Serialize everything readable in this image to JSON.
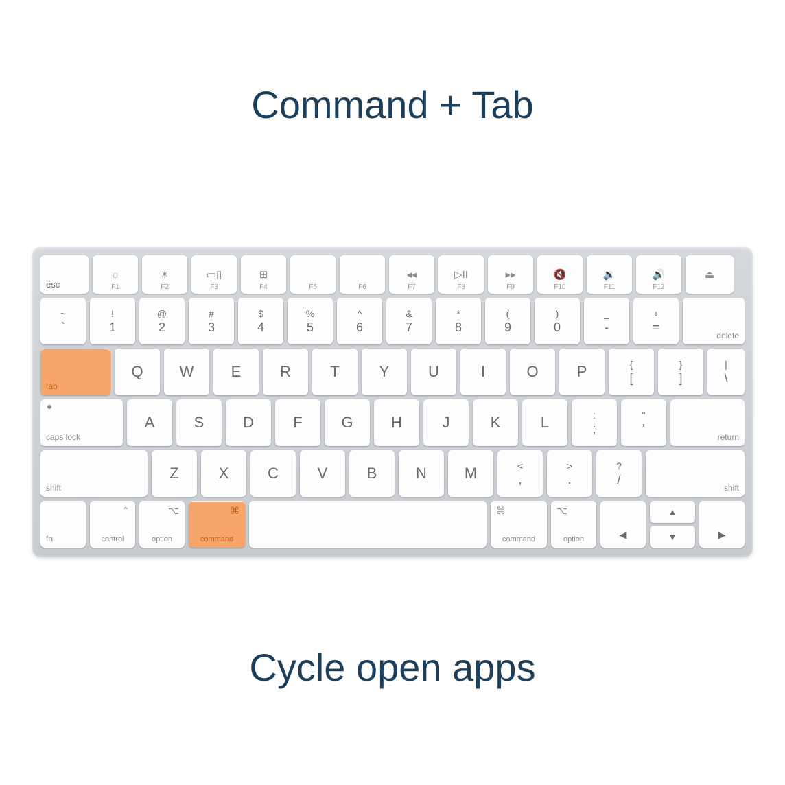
{
  "title": "Command + Tab",
  "caption": "Cycle open apps",
  "highlight_color": "#f7a56b",
  "keyboard": {
    "fn_row": {
      "esc": "esc",
      "keys": [
        {
          "icon": "☼",
          "label": "F1"
        },
        {
          "icon": "☀",
          "label": "F2"
        },
        {
          "icon": "▭▯",
          "label": "F3"
        },
        {
          "icon": "⊞",
          "label": "F4"
        },
        {
          "icon": "",
          "label": "F5"
        },
        {
          "icon": "",
          "label": "F6"
        },
        {
          "icon": "◂◂",
          "label": "F7"
        },
        {
          "icon": "▷II",
          "label": "F8"
        },
        {
          "icon": "▸▸",
          "label": "F9"
        },
        {
          "icon": "🔇",
          "label": "F10"
        },
        {
          "icon": "🔉",
          "label": "F11"
        },
        {
          "icon": "🔊",
          "label": "F12"
        }
      ],
      "eject": "⏏"
    },
    "num_row": [
      {
        "top": "~",
        "bot": "`"
      },
      {
        "top": "!",
        "bot": "1"
      },
      {
        "top": "@",
        "bot": "2"
      },
      {
        "top": "#",
        "bot": "3"
      },
      {
        "top": "$",
        "bot": "4"
      },
      {
        "top": "%",
        "bot": "5"
      },
      {
        "top": "^",
        "bot": "6"
      },
      {
        "top": "&",
        "bot": "7"
      },
      {
        "top": "*",
        "bot": "8"
      },
      {
        "top": "(",
        "bot": "9"
      },
      {
        "top": ")",
        "bot": "0"
      },
      {
        "top": "_",
        "bot": "-"
      },
      {
        "top": "+",
        "bot": "="
      }
    ],
    "delete": "delete",
    "tab": "tab",
    "q_row": [
      "Q",
      "W",
      "E",
      "R",
      "T",
      "Y",
      "U",
      "I",
      "O",
      "P"
    ],
    "brackets": [
      {
        "top": "{",
        "bot": "["
      },
      {
        "top": "}",
        "bot": "]"
      },
      {
        "top": "|",
        "bot": "\\"
      }
    ],
    "caps": "caps lock",
    "a_row": [
      "A",
      "S",
      "D",
      "F",
      "G",
      "H",
      "J",
      "K",
      "L"
    ],
    "punct_a": [
      {
        "top": ":",
        "bot": ";"
      },
      {
        "top": "\"",
        "bot": "'"
      }
    ],
    "return": "return",
    "shift": "shift",
    "z_row": [
      "Z",
      "X",
      "C",
      "V",
      "B",
      "N",
      "M"
    ],
    "punct_z": [
      {
        "top": "<",
        "bot": ","
      },
      {
        "top": ">",
        "bot": "."
      },
      {
        "top": "?",
        "bot": "/"
      }
    ],
    "bottom": {
      "fn": "fn",
      "control": {
        "sym": "⌃",
        "label": "control"
      },
      "option": {
        "sym": "⌥",
        "label": "option"
      },
      "command": {
        "sym": "⌘",
        "label": "command"
      },
      "arrows": {
        "left": "◀",
        "up": "▲",
        "down": "▼",
        "right": "▶"
      }
    }
  },
  "highlighted_keys": [
    "tab",
    "command-left"
  ]
}
